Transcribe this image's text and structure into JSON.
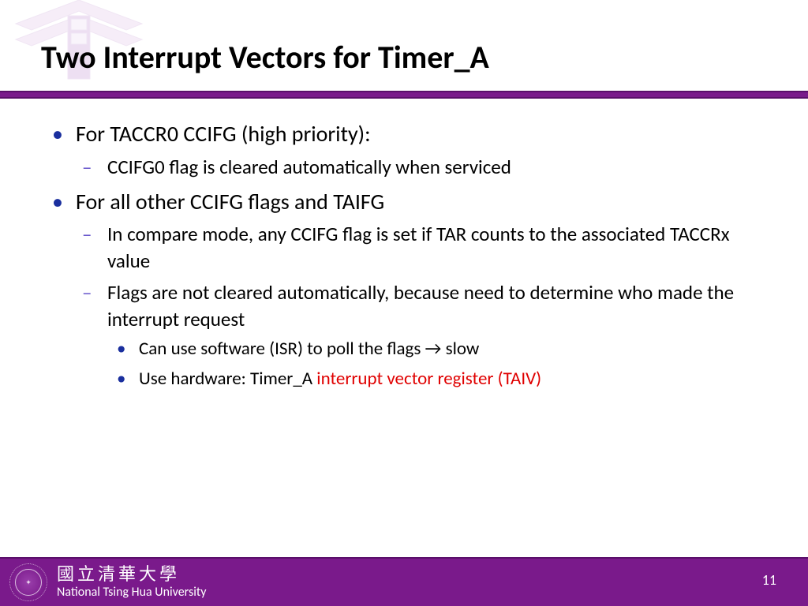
{
  "title": "Two Interrupt Vectors for Timer_A",
  "bullets": {
    "b1": "For TACCR0 CCIFG (high priority):",
    "b1_1": "CCIFG0 flag is cleared automatically when serviced",
    "b2": "For all other CCIFG flags and TAIFG",
    "b2_1": "In compare mode, any CCIFG flag is set if TAR counts to the associated TACCRx value",
    "b2_2": "Flags are not cleared automatically, because need to determine who made the interrupt request",
    "b2_2a": "Can use software (ISR) to poll the flags → slow",
    "b2_2b_pre": "Use hardware: Timer_A ",
    "b2_2b_red": "interrupt vector register (TAIV)"
  },
  "footer": {
    "chinese": "國立清華大學",
    "english": "National Tsing Hua University"
  },
  "page": "11"
}
